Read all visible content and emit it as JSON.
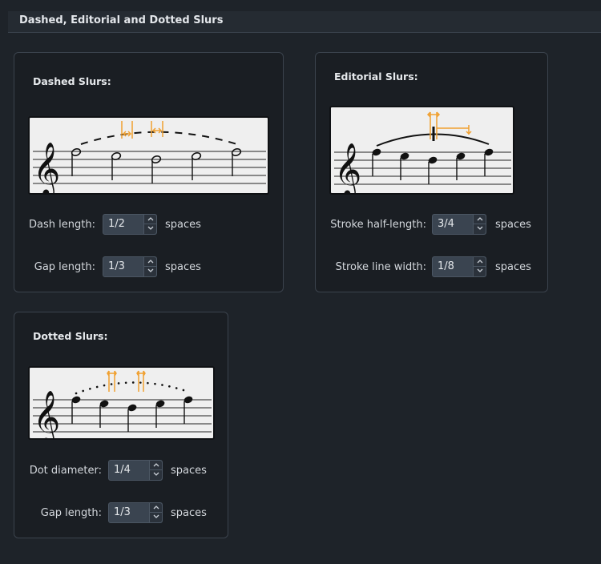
{
  "section": {
    "title": "Dashed, Editorial and Dotted Slurs"
  },
  "dashed": {
    "title": "Dashed Slurs:",
    "fields": [
      {
        "label": "Dash length:",
        "value": "1/2",
        "unit": "spaces"
      },
      {
        "label": "Gap length:",
        "value": "1/3",
        "unit": "spaces"
      }
    ]
  },
  "editorial": {
    "title": "Editorial Slurs:",
    "fields": [
      {
        "label": "Stroke half-length:",
        "value": "3/4",
        "unit": "spaces"
      },
      {
        "label": "Stroke line width:",
        "value": "1/8",
        "unit": "spaces"
      }
    ]
  },
  "dotted": {
    "title": "Dotted Slurs:",
    "fields": [
      {
        "label": "Dot diameter:",
        "value": "1/4",
        "unit": "spaces"
      },
      {
        "label": "Gap length:",
        "value": "1/3",
        "unit": "spaces"
      }
    ]
  },
  "colors": {
    "accent": "#f0a030",
    "panel": "#1a1e23",
    "preview": "#efefef"
  },
  "icons": [
    "treble-clef-icon",
    "spin-up-icon",
    "spin-down-icon"
  ]
}
